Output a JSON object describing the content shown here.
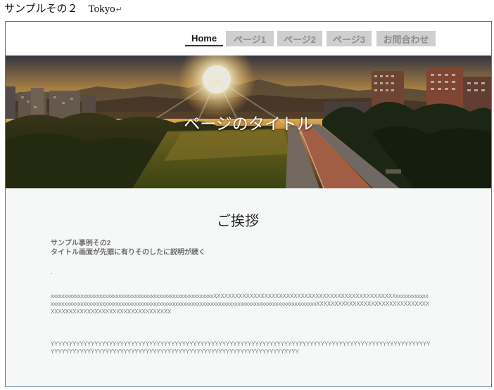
{
  "document": {
    "caption": "サンプルその２　Tokyo",
    "return_mark": "↵"
  },
  "nav": {
    "items": [
      {
        "label": "Home",
        "active": true
      },
      {
        "label": "ページ1",
        "active": false
      },
      {
        "label": "ページ2",
        "active": false
      },
      {
        "label": "ページ3",
        "active": false
      },
      {
        "label": "お問合わせ",
        "active": false
      }
    ]
  },
  "hero": {
    "title": "ページのタイトル"
  },
  "content": {
    "heading": "ご挨拶",
    "intro_line1": "サンプル事例その2",
    "intro_line2": "タイトル画面が先頭に有りそのしたに説明が続く",
    "dot": ".",
    "x_paragraph": "xxxxxxxxxxxxxxxxxxxxxxxxxxxxxxxxxxxxxxxxxxxxxxxxxxxxxxxxxxxxXXXXXXXXXXXXXXXXXXXXXXXXXXXXXXXXXXXXXXXXXXXXXXXXXXxxxxxxxxxxxxxxxxxxxxxxxxxxxxxxxxxxxxxxxxxxxxxxxxxxxxxxxxxxxxxxxxxxxxxxxxxxxxxxxxxxxxxxxxxxxxxxxxxxxxxxxxxxxxxxXXXXXXXXXXXXXXXXXXXXXXXXXXXXXXXXXXXXXXXXXXXXXXXXXXXXXXXXXXXXXXXX",
    "y_paragraph": "YYYYYYYYYYYYYYYYYYYYYYYYYYYYYYYYYYYYYYYYYYYYYYYYYYYYYYYYYYYYYYYYYYYYYYYYYYYYYYYYYYYYYYYYYYYYYYYYYYYYYYYYYYYYYYYYYYYYYYYYYYYYYYYYYYYYYYYYYYYYYYYYYYYYYYYYYYYYYYYYYYYYYYYYYYYY"
  },
  "colors": {
    "frame_border": "#4f77aa",
    "nav_inactive_bg": "#cfcfcf",
    "nav_inactive_text": "#8e8e8e",
    "nav_active_text": "#1a1a1a"
  }
}
